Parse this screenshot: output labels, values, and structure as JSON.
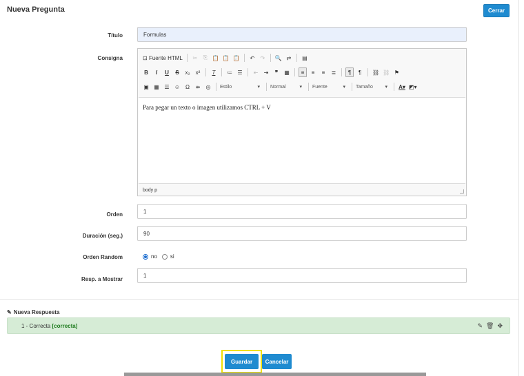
{
  "header": {
    "title": "Nueva Pregunta",
    "close_label": "Cerrar"
  },
  "form": {
    "titulo": {
      "label": "Título",
      "value": "Formulas"
    },
    "consigna": {
      "label": "Consigna",
      "toolbar": {
        "source_label": "Fuente HTML",
        "estilo": "Estilo",
        "normal": "Normal",
        "fuente": "Fuente",
        "tamano": "Tamaño"
      },
      "body_text": "Para pegar un texto o imagen utilizamos CTRL + V",
      "path": "body  p"
    },
    "orden": {
      "label": "Orden",
      "value": "1"
    },
    "duracion": {
      "label": "Duración (seg.)",
      "value": "90"
    },
    "orden_random": {
      "label": "Orden Random",
      "option_no": "no",
      "option_si": "si",
      "selected": "no"
    },
    "resp_mostrar": {
      "label": "Resp. a Mostrar",
      "value": "1"
    }
  },
  "respuestas": {
    "title": "Nueva Respuesta",
    "items": [
      {
        "prefix": "1 - Correcta ",
        "tag": "[correcta]"
      }
    ]
  },
  "footer": {
    "save_label": "Guardar",
    "cancel_label": "Cancelar"
  },
  "colors": {
    "primary": "#1f8bd0",
    "answer_bg": "#d6ecd6",
    "highlight": "#f0e000"
  }
}
